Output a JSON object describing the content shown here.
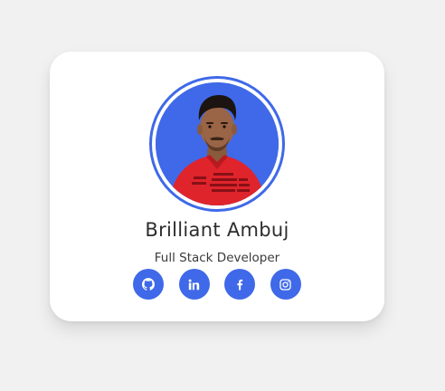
{
  "profile": {
    "name": "Brilliant Ambuj",
    "title": "Full Stack Developer"
  },
  "social_links": [
    {
      "icon": "github-icon"
    },
    {
      "icon": "linkedin-icon"
    },
    {
      "icon": "facebook-icon"
    },
    {
      "icon": "instagram-icon"
    }
  ],
  "colors": {
    "accent": "#3f69e8",
    "card_background": "#ffffff",
    "page_background": "#f1f1f1",
    "text_primary": "#2d2d2d"
  }
}
